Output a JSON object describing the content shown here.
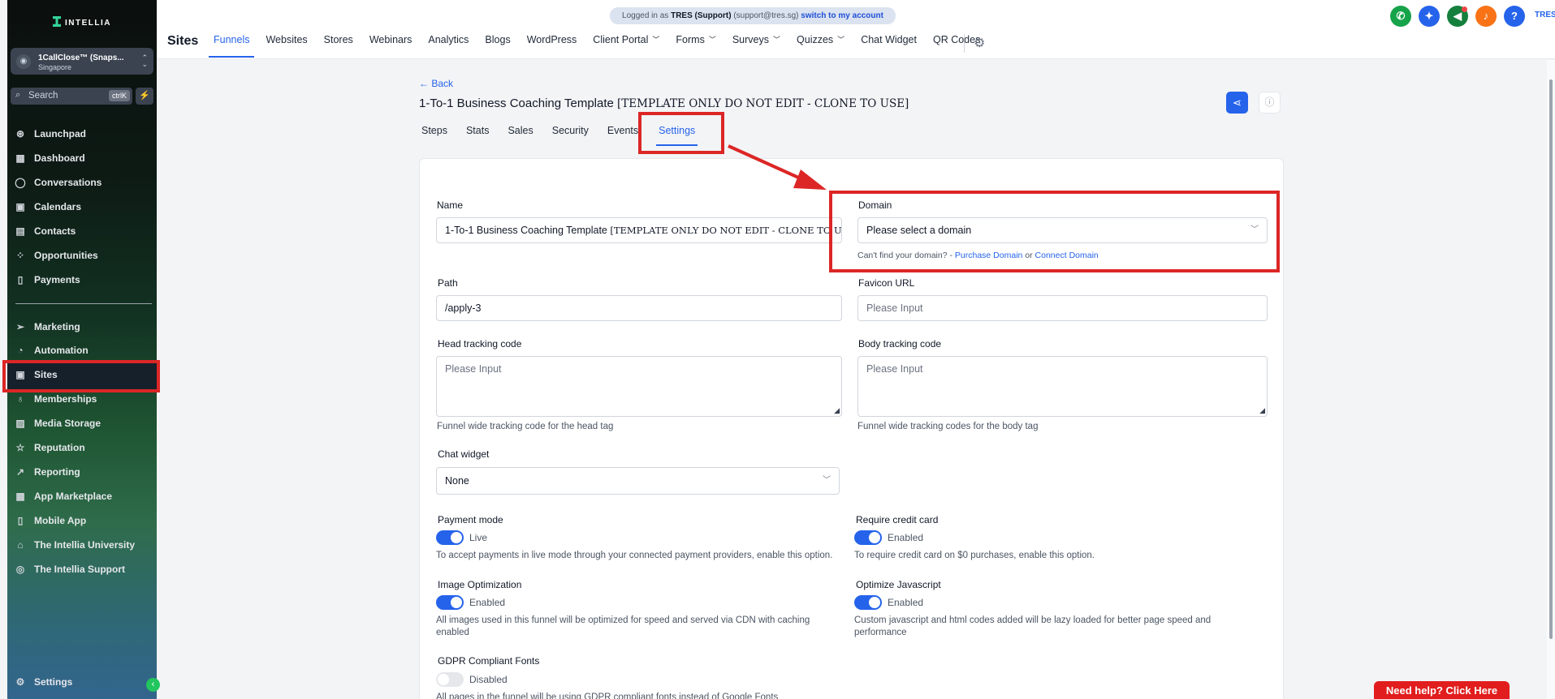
{
  "sidebar": {
    "logo": "INTELLIA",
    "account": {
      "name": "1CallClose™ (Snaps...",
      "location": "Singapore"
    },
    "search": {
      "placeholder": "Search",
      "shortcut": "ctrlK"
    },
    "items_top": [
      {
        "label": "Launchpad",
        "icon": "rocket-icon"
      },
      {
        "label": "Dashboard",
        "icon": "grid-icon"
      },
      {
        "label": "Conversations",
        "icon": "chat-icon"
      },
      {
        "label": "Calendars",
        "icon": "calendar-icon"
      },
      {
        "label": "Contacts",
        "icon": "contacts-icon"
      },
      {
        "label": "Opportunities",
        "icon": "pipeline-icon"
      },
      {
        "label": "Payments",
        "icon": "payments-icon"
      }
    ],
    "items_bottom": [
      {
        "label": "Marketing",
        "icon": "send-icon"
      },
      {
        "label": "Automation",
        "icon": "automation-icon"
      },
      {
        "label": "Sites",
        "icon": "sites-icon"
      },
      {
        "label": "Memberships",
        "icon": "award-icon"
      },
      {
        "label": "Media Storage",
        "icon": "image-icon"
      },
      {
        "label": "Reputation",
        "icon": "star-icon"
      },
      {
        "label": "Reporting",
        "icon": "trend-icon"
      },
      {
        "label": "App Marketplace",
        "icon": "apps-icon"
      },
      {
        "label": "Mobile App",
        "icon": "mobile-icon"
      },
      {
        "label": "The Intellia University",
        "icon": "graduation-icon"
      },
      {
        "label": "The Intellia Support",
        "icon": "support-icon"
      }
    ],
    "settings": "Settings"
  },
  "topbar": {
    "banner": {
      "prefix": "Logged in as",
      "user": "TRES (Support)",
      "email": "(support@tres.sg)",
      "link": "switch to my account"
    },
    "title": "Sites",
    "nav": [
      {
        "label": "Funnels",
        "active": true,
        "dropdown": false
      },
      {
        "label": "Websites",
        "active": false,
        "dropdown": false
      },
      {
        "label": "Stores",
        "active": false,
        "dropdown": false
      },
      {
        "label": "Webinars",
        "active": false,
        "dropdown": false
      },
      {
        "label": "Analytics",
        "active": false,
        "dropdown": false
      },
      {
        "label": "Blogs",
        "active": false,
        "dropdown": false
      },
      {
        "label": "WordPress",
        "active": false,
        "dropdown": false
      },
      {
        "label": "Client Portal",
        "active": false,
        "dropdown": true
      },
      {
        "label": "Forms",
        "active": false,
        "dropdown": true
      },
      {
        "label": "Surveys",
        "active": false,
        "dropdown": true
      },
      {
        "label": "Quizzes",
        "active": false,
        "dropdown": true
      },
      {
        "label": "Chat Widget",
        "active": false,
        "dropdown": false
      },
      {
        "label": "QR Codes",
        "active": false,
        "dropdown": false
      }
    ],
    "user_initials": "TRES",
    "icon_colors": {
      "phone": "#16a34a",
      "magic": "#2563eb",
      "megaphone": "#15803d",
      "bell": "#f97316",
      "help": "#2563eb"
    }
  },
  "page": {
    "back": "Back",
    "title_main": "1-To-1 Business Coaching Template ",
    "title_tag": "[TEMPLATE ONLY DO NOT EDIT - CLONE TO USE]",
    "tabs": [
      {
        "label": "Steps",
        "active": false
      },
      {
        "label": "Stats",
        "active": false
      },
      {
        "label": "Sales",
        "active": false
      },
      {
        "label": "Security",
        "active": false
      },
      {
        "label": "Events",
        "active": false
      },
      {
        "label": "Settings",
        "active": true
      }
    ]
  },
  "form": {
    "name": {
      "label": "Name",
      "value_main": "1-To-1 Business Coaching Template ",
      "value_tag": "[TEMPLATE ONLY DO NOT EDIT - CLONE TO USE]"
    },
    "domain": {
      "label": "Domain",
      "placeholder": "Please select a domain",
      "help_prefix": "Can't find your domain? - ",
      "purchase": "Purchase Domain",
      "or": " or ",
      "connect": "Connect Domain"
    },
    "path": {
      "label": "Path",
      "value": "/apply-3"
    },
    "favicon": {
      "label": "Favicon URL",
      "placeholder": "Please Input"
    },
    "head_code": {
      "label": "Head tracking code",
      "placeholder": "Please Input",
      "help": "Funnel wide tracking code for the head tag"
    },
    "body_code": {
      "label": "Body tracking code",
      "placeholder": "Please Input",
      "help": "Funnel wide tracking codes for the body tag"
    },
    "chat_widget": {
      "label": "Chat widget",
      "value": "None"
    },
    "payment_mode": {
      "label": "Payment mode",
      "state": "Live",
      "on": true,
      "help": "To accept payments in live mode through your connected payment providers, enable this option."
    },
    "require_card": {
      "label": "Require credit card",
      "state": "Enabled",
      "on": true,
      "help": "To require credit card on $0 purchases, enable this option."
    },
    "image_opt": {
      "label": "Image Optimization",
      "state": "Enabled",
      "on": true,
      "help": "All images used in this funnel will be optimized for speed and served via CDN with caching enabled"
    },
    "optimize_js": {
      "label": "Optimize Javascript",
      "state": "Enabled",
      "on": true,
      "help": "Custom javascript and html codes added will be lazy loaded for better page speed and performance"
    },
    "gdpr": {
      "label": "GDPR Compliant Fonts",
      "state": "Disabled",
      "on": false,
      "help": "All pages in the funnel will be using GDPR compliant fonts instead of Google Fonts"
    }
  },
  "need_help": "Need help? Click Here",
  "colors": {
    "accent": "#2563eb",
    "highlight": "#dc2626"
  }
}
